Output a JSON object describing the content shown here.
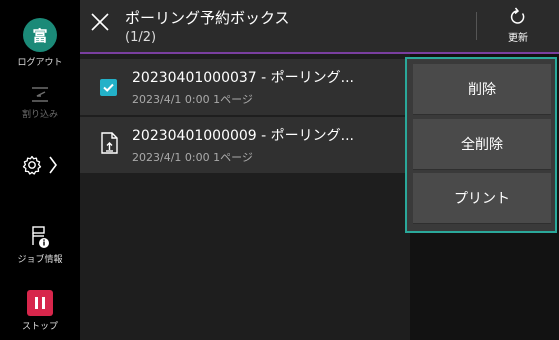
{
  "sidebar": {
    "avatar_char": "富",
    "logout_label": "ログアウト",
    "interrupt_label": "割り込み",
    "job_info_label": "ジョブ情報",
    "stop_label": "ストップ"
  },
  "header": {
    "title": "ポーリング予約ボックス",
    "page_indicator": "(1/2)",
    "refresh_label": "更新"
  },
  "list": {
    "rows": [
      {
        "title": "20230401000037 - ポーリング...",
        "subtitle": "2023/4/1 0:00 1ページ",
        "checked": true
      },
      {
        "title": "20230401000009 - ポーリング...",
        "subtitle": "2023/4/1 0:00 1ページ",
        "checked": false
      }
    ]
  },
  "menu": {
    "items": [
      "削除",
      "全削除",
      "プリント"
    ]
  },
  "colors": {
    "accent_teal": "#23b1c8",
    "menu_border": "#2aa89a",
    "header_underline": "#7a3fa0",
    "stop_red": "#d7264b",
    "avatar_green": "#1b8a78"
  }
}
